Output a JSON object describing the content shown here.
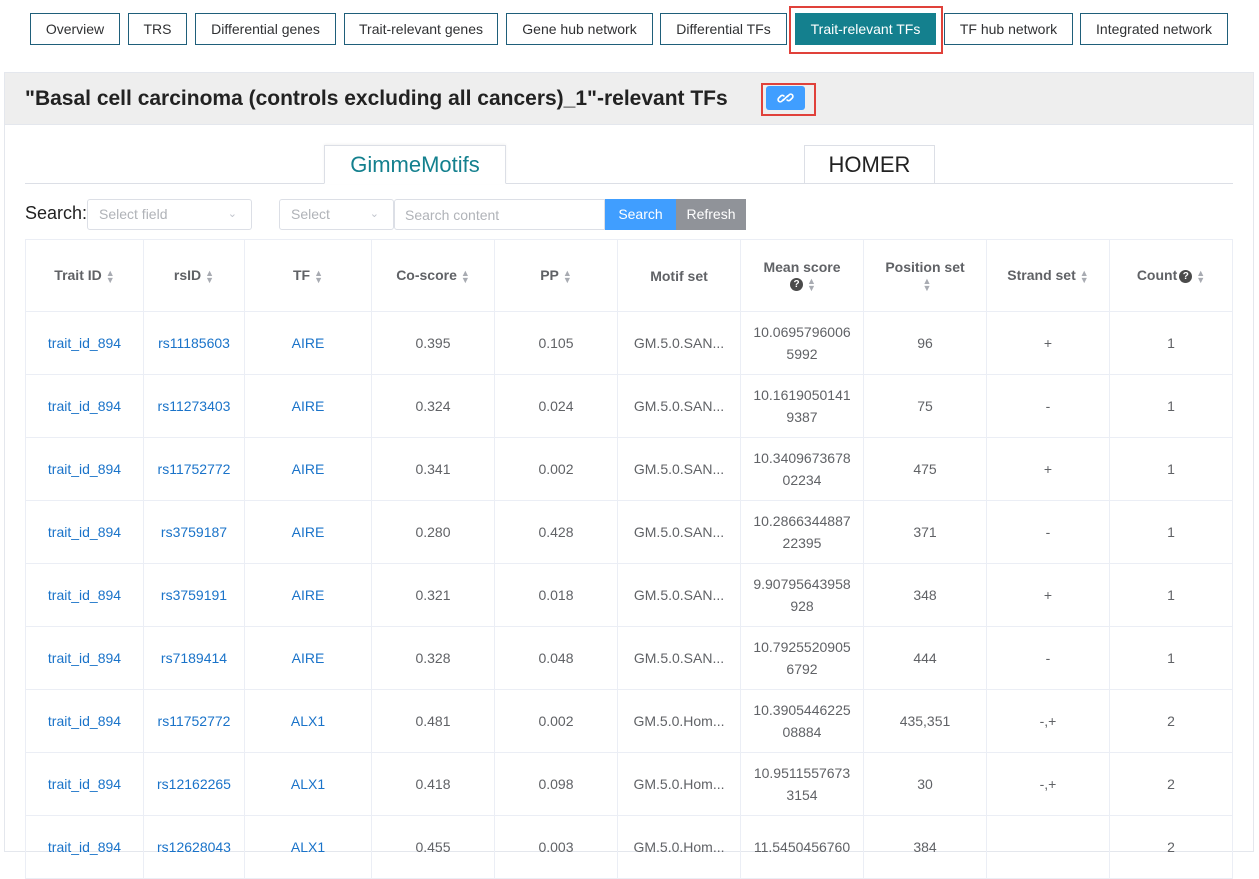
{
  "nav": {
    "items": [
      {
        "label": "Overview",
        "active": false
      },
      {
        "label": "TRS",
        "active": false
      },
      {
        "label": "Differential genes",
        "active": false
      },
      {
        "label": "Trait-relevant genes",
        "active": false
      },
      {
        "label": "Gene hub network",
        "active": false
      },
      {
        "label": "Differential TFs",
        "active": false
      },
      {
        "label": "Trait-relevant TFs",
        "active": true
      },
      {
        "label": "TF hub network",
        "active": false
      },
      {
        "label": "Integrated network",
        "active": false
      }
    ]
  },
  "header": {
    "title": "\"Basal cell carcinoma (controls excluding all cancers)_1\"-relevant TFs",
    "link_icon": "link-icon"
  },
  "tabs": [
    {
      "label": "GimmeMotifs",
      "active": true
    },
    {
      "label": "HOMER",
      "active": false
    }
  ],
  "search": {
    "label": "Search:",
    "field_placeholder": "Select field",
    "select_placeholder": "Select",
    "content_placeholder": "Search content",
    "search_button": "Search",
    "refresh_button": "Refresh"
  },
  "table": {
    "columns": [
      "Trait ID",
      "rsID",
      "TF",
      "Co-score",
      "PP",
      "Motif set",
      "Mean score",
      "Position set",
      "Strand set",
      "Count"
    ],
    "rows": [
      [
        "trait_id_894",
        "rs11185603",
        "AIRE",
        "0.395",
        "0.105",
        "GM.5.0.SAN...",
        "10.0695796006\n5992",
        "96",
        "+",
        "1"
      ],
      [
        "trait_id_894",
        "rs11273403",
        "AIRE",
        "0.324",
        "0.024",
        "GM.5.0.SAN...",
        "10.1619050141\n9387",
        "75",
        "-",
        "1"
      ],
      [
        "trait_id_894",
        "rs11752772",
        "AIRE",
        "0.341",
        "0.002",
        "GM.5.0.SAN...",
        "10.3409673678\n02234",
        "475",
        "+",
        "1"
      ],
      [
        "trait_id_894",
        "rs3759187",
        "AIRE",
        "0.280",
        "0.428",
        "GM.5.0.SAN...",
        "10.2866344887\n22395",
        "371",
        "-",
        "1"
      ],
      [
        "trait_id_894",
        "rs3759191",
        "AIRE",
        "0.321",
        "0.018",
        "GM.5.0.SAN...",
        "9.90795643958\n928",
        "348",
        "+",
        "1"
      ],
      [
        "trait_id_894",
        "rs7189414",
        "AIRE",
        "0.328",
        "0.048",
        "GM.5.0.SAN...",
        "10.7925520905\n6792",
        "444",
        "-",
        "1"
      ],
      [
        "trait_id_894",
        "rs11752772",
        "ALX1",
        "0.481",
        "0.002",
        "GM.5.0.Hom...",
        "10.3905446225\n08884",
        "435,351",
        "-,+",
        "2"
      ],
      [
        "trait_id_894",
        "rs12162265",
        "ALX1",
        "0.418",
        "0.098",
        "GM.5.0.Hom...",
        "10.9511557673\n3154",
        "30",
        "-,+",
        "2"
      ],
      [
        "trait_id_894",
        "rs12628043",
        "ALX1",
        "0.455",
        "0.003",
        "GM.5.0.Hom...",
        "11.5450456760\n",
        "384",
        "",
        "2"
      ]
    ]
  }
}
